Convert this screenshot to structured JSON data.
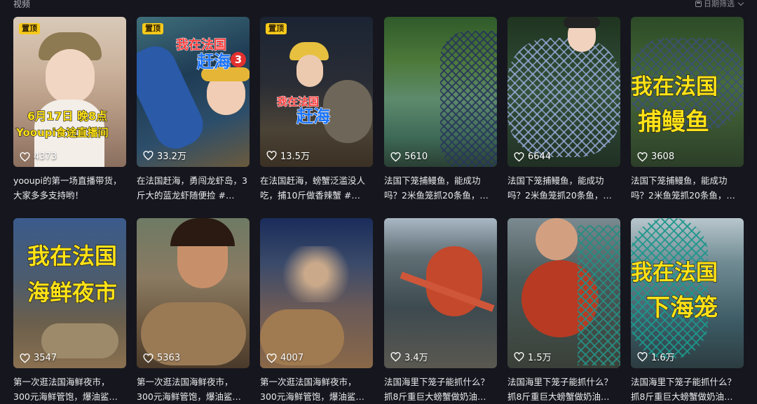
{
  "header": {
    "section_title": "视频",
    "date_filter_label": "日期筛选",
    "date_filter_icon": "calendar-icon",
    "chevron_icon": "chevron-down-icon"
  },
  "colors": {
    "background": "#16161e",
    "pin_badge": "#f6c91a",
    "overlay_yellow": "#ffe218",
    "overlay_red": "#ff3b3b",
    "overlay_blue": "#1a74ff"
  },
  "videos": [
    {
      "pin": "置顶",
      "likes": "4373",
      "desc": "yooupi的第一场直播带货，大家多多支持哟！",
      "overlay": [
        "6月17日 晚8点",
        "Yooupi食途直播间"
      ]
    },
    {
      "pin": "置顶",
      "likes": "33.2万",
      "desc": "在法国赶海，勇闯龙虾岛，3斤大的蓝龙虾随便捡 #…",
      "overlay": [
        "我在法国",
        "赶海",
        "3"
      ]
    },
    {
      "pin": "置顶",
      "likes": "13.5万",
      "desc": "在法国赶海，螃蟹泛滥没人吃，捕10斤做香辣蟹 #…",
      "overlay": [
        "我在法国",
        "赶海"
      ]
    },
    {
      "pin": "",
      "likes": "5610",
      "desc": "法国下笼捕鳗鱼，能成功吗？2米鱼笼抓20条鱼，…",
      "overlay": []
    },
    {
      "pin": "",
      "likes": "6644",
      "desc": "法国下笼捕鳗鱼，能成功吗？2米鱼笼抓20条鱼，…",
      "overlay": []
    },
    {
      "pin": "",
      "likes": "3608",
      "desc": "法国下笼捕鳗鱼，能成功吗？2米鱼笼抓20条鱼，…",
      "overlay": [
        "我在法国",
        "捕鳗鱼"
      ]
    },
    {
      "pin": "",
      "likes": "3547",
      "desc": "第一次逛法国海鲜夜市，300元海鲜管饱，爆油鲨…",
      "overlay": [
        "我在法国",
        "海鲜夜市"
      ]
    },
    {
      "pin": "",
      "likes": "5363",
      "desc": "第一次逛法国海鲜夜市，300元海鲜管饱，爆油鲨…",
      "overlay": []
    },
    {
      "pin": "",
      "likes": "4007",
      "desc": "第一次逛法国海鲜夜市，300元海鲜管饱，爆油鲨…",
      "overlay": []
    },
    {
      "pin": "",
      "likes": "3.4万",
      "desc": "法国海里下笼子能抓什么？抓8斤重巨大螃蟹做奶油…",
      "overlay": []
    },
    {
      "pin": "",
      "likes": "1.5万",
      "desc": "法国海里下笼子能抓什么？抓8斤重巨大螃蟹做奶油…",
      "overlay": []
    },
    {
      "pin": "",
      "likes": "1.6万",
      "desc": "法国海里下笼子能抓什么？抓8斤重巨大螃蟹做奶油…",
      "overlay": [
        "我在法国",
        "下海笼"
      ]
    }
  ]
}
